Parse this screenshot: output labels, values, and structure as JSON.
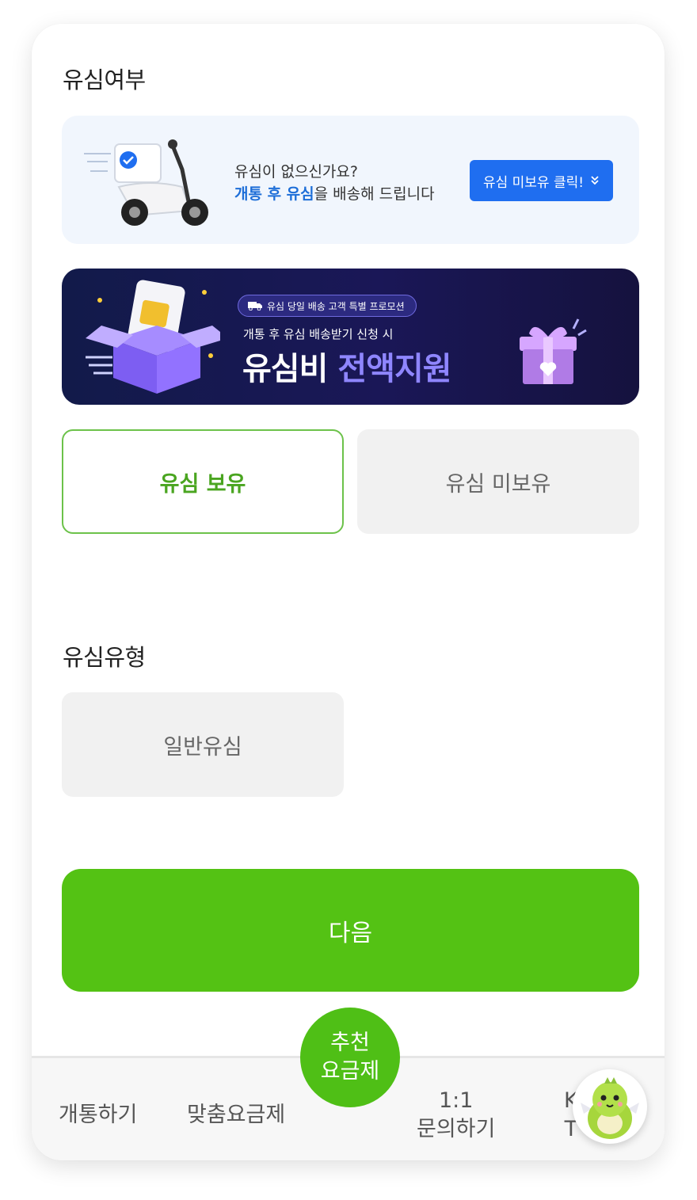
{
  "sim_status": {
    "title": "유심여부",
    "delivery_banner": {
      "line1": "유심이 없으신가요?",
      "line2_highlight": "개통 후 유심",
      "line2_rest": "을 배송해 드립니다",
      "button_label": "유심 미보유 클릭!",
      "button_icon": "double-chevron-down-icon"
    },
    "promo_banner": {
      "badge": "유심 당일 배송 고객 특별 프로모션",
      "subtitle": "개통 후 유심 배송받기 신청 시",
      "headline_white": "유심비",
      "headline_purple": "전액지원",
      "accent_color": "#8f86ff"
    },
    "options": [
      {
        "label": "유심 보유",
        "selected": true
      },
      {
        "label": "유심 미보유",
        "selected": false
      }
    ]
  },
  "sim_type": {
    "title": "유심유형",
    "options": [
      {
        "label": "일반유심",
        "selected": false
      }
    ]
  },
  "next_button": {
    "label": "다음",
    "color": "#54c214"
  },
  "bottom_nav": {
    "items": [
      {
        "label": "개통하기"
      },
      {
        "label": "맞춤요금제"
      },
      {
        "label_line1": "추천",
        "label_line2": "요금제"
      },
      {
        "label_line1": "1:1",
        "label_line2": "문의하기"
      },
      {
        "label_line1": "K",
        "label_line2": "T"
      }
    ]
  },
  "colors": {
    "primary_green": "#54c214",
    "selected_border": "#6cc24a",
    "blue_button": "#1f6ef0",
    "promo_bg": "#1a1757"
  }
}
